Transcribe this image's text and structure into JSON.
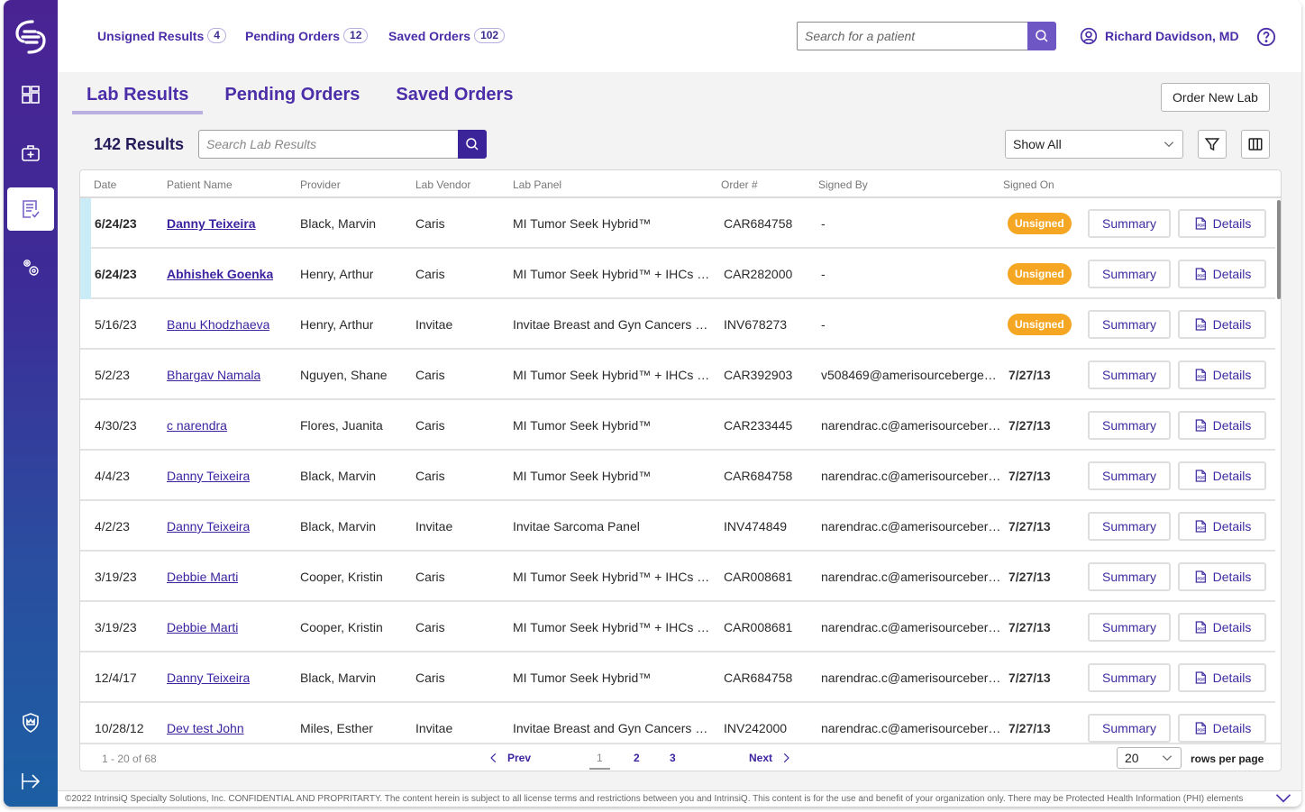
{
  "header": {
    "quick_links": [
      {
        "label": "Unsigned Results",
        "count": "4"
      },
      {
        "label": "Pending Orders",
        "count": "12"
      },
      {
        "label": "Saved Orders",
        "count": "102"
      }
    ],
    "patient_search_placeholder": "Search for a patient",
    "user_name": "Richard Davidson, MD"
  },
  "sidebar": {
    "items": [
      {
        "icon": "dashboard-icon"
      },
      {
        "icon": "medical-bag-icon"
      },
      {
        "icon": "lab-results-icon",
        "active": true
      },
      {
        "icon": "settings-gears-icon"
      },
      {
        "icon": "shield-crown-icon"
      },
      {
        "icon": "logout-icon"
      }
    ]
  },
  "tabs": [
    {
      "label": "Lab Results",
      "active": true
    },
    {
      "label": "Pending Orders"
    },
    {
      "label": "Saved Orders"
    }
  ],
  "order_new_lab_label": "Order New Lab",
  "results": {
    "count_label": "142 Results",
    "search_placeholder": "Search Lab Results",
    "filter_value": "Show All"
  },
  "table": {
    "columns": [
      "Date",
      "Patient Name",
      "Provider",
      "Lab Vendor",
      "Lab Panel",
      "Order #",
      "Signed By",
      "Signed On"
    ],
    "summary_label": "Summary",
    "details_label": "Details",
    "unsigned_label": "Unsigned",
    "rows": [
      {
        "date": "6/24/23",
        "patient": "Danny Teixeira",
        "provider": "Black, Marvin",
        "vendor": "Caris",
        "panel": "MI Tumor Seek Hybrid™",
        "order": "CAR684758",
        "signed_by": "-",
        "signed_on": "",
        "status": "unsigned",
        "unread": true
      },
      {
        "date": "6/24/23",
        "patient": "Abhishek Goenka",
        "provider": "Henry, Arthur",
        "vendor": "Caris",
        "panel": "MI Tumor Seek Hybrid™ + IHCs an...",
        "order": "CAR282000",
        "signed_by": "-",
        "signed_on": "",
        "status": "unsigned",
        "unread": true
      },
      {
        "date": "5/16/23",
        "patient": "Banu Khodzhaeva",
        "provider": "Henry, Arthur",
        "vendor": "Invitae",
        "panel": "Invitae Breast and Gyn Cancers Pa...",
        "order": "INV678273",
        "signed_by": "-",
        "signed_on": "",
        "status": "unsigned",
        "unread": false
      },
      {
        "date": "5/2/23",
        "patient": "Bhargav Namala",
        "provider": "Nguyen, Shane",
        "vendor": "Caris",
        "panel": "MI Tumor Seek Hybrid™ + IHCs an...",
        "order": "CAR392903",
        "signed_by": "v508469@amerisourcebergen....",
        "signed_on": "7/27/13",
        "status": "signed",
        "unread": false
      },
      {
        "date": "4/30/23",
        "patient": "c narendra",
        "provider": "Flores, Juanita",
        "vendor": "Caris",
        "panel": "MI Tumor Seek Hybrid™",
        "order": "CAR233445",
        "signed_by": "narendrac.c@amerisourceberg...",
        "signed_on": "7/27/13",
        "status": "signed",
        "unread": false
      },
      {
        "date": "4/4/23",
        "patient": "Danny Teixeira",
        "provider": "Black, Marvin",
        "vendor": "Caris",
        "panel": "MI Tumor Seek Hybrid™",
        "order": "CAR684758",
        "signed_by": "narendrac.c@amerisourceberg...",
        "signed_on": "7/27/13",
        "status": "signed",
        "unread": false
      },
      {
        "date": "4/2/23",
        "patient": "Danny Teixeira",
        "provider": "Black, Marvin",
        "vendor": "Invitae",
        "panel": "Invitae Sarcoma Panel",
        "order": "INV474849",
        "signed_by": "narendrac.c@amerisourceberg...",
        "signed_on": "7/27/13",
        "status": "signed",
        "unread": false
      },
      {
        "date": "3/19/23",
        "patient": "Debbie Marti",
        "provider": "Cooper, Kristin",
        "vendor": "Caris",
        "panel": "MI Tumor Seek Hybrid™ + IHCs an...",
        "order": "CAR008681",
        "signed_by": "narendrac.c@amerisourceberg...",
        "signed_on": "7/27/13",
        "status": "signed",
        "unread": false
      },
      {
        "date": "3/19/23",
        "patient": "Debbie Marti",
        "provider": "Cooper, Kristin",
        "vendor": "Caris",
        "panel": "MI Tumor Seek Hybrid™ + IHCs an...",
        "order": "CAR008681",
        "signed_by": "narendrac.c@amerisourceberg...",
        "signed_on": "7/27/13",
        "status": "signed",
        "unread": false
      },
      {
        "date": "12/4/17",
        "patient": "Danny Teixeira",
        "provider": "Black, Marvin",
        "vendor": "Caris",
        "panel": "MI Tumor Seek Hybrid™",
        "order": "CAR684758",
        "signed_by": "narendrac.c@amerisourceberg...",
        "signed_on": "7/27/13",
        "status": "signed",
        "unread": false
      },
      {
        "date": "10/28/12",
        "patient": "Dev test John",
        "provider": "Miles, Esther",
        "vendor": "Invitae",
        "panel": "Invitae Breast and Gyn Cancers Pa...",
        "order": "INV242000",
        "signed_by": "narendrac.c@amerisourceberg...",
        "signed_on": "7/27/13",
        "status": "signed",
        "unread": false
      }
    ]
  },
  "pagination": {
    "range": "1 - 20 of 68",
    "prev_label": "Prev",
    "next_label": "Next",
    "pages": [
      "1",
      "2",
      "3"
    ],
    "current_page": "1",
    "rows_per_page": "20",
    "rows_per_page_label": "rows per page"
  },
  "footer": {
    "text": "©2022 IntrinsiQ Specialty Solutions, Inc. CONFIDENTIAL AND PROPRITARTY.  The content herein is subject to all license terms and restrictions between you and IntrinsiQ.  This content is for the use and benefit of your organization only. There may be Protected Health Information (PHI) elements"
  },
  "colors": {
    "brand_purple": "#4b2ea8",
    "unsigned_badge": "#f5a623",
    "unread_indicator": "#c9ecf7",
    "search_button": "#6e56c4"
  }
}
